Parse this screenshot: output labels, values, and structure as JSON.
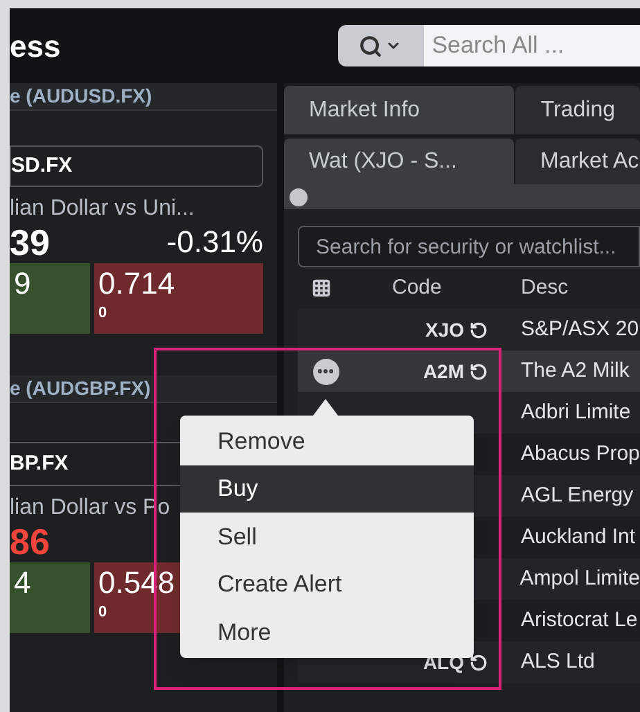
{
  "header": {
    "title": "ess",
    "search": {
      "placeholder": "Search All ..."
    }
  },
  "fx_cards": [
    {
      "title": "e (AUDUSD.FX)",
      "code": "SD.FX",
      "name": "lian Dollar vs Uni...",
      "price": {
        "text": "39",
        "color": "#ffffff"
      },
      "change": "-0.31%",
      "bid": "9",
      "ask": "0.714",
      "ask_volume": "0"
    },
    {
      "title": "e (AUDGBP.FX)",
      "code": "BP.FX",
      "name": "lian Dollar vs Po",
      "price": {
        "text": "86",
        "color": "#f0443c"
      },
      "bid": "4",
      "ask": "0.548",
      "ask_volume": "0"
    }
  ],
  "tabs": [
    {
      "label": "Market Info",
      "selected": true
    },
    {
      "label": "Trading",
      "selected": false
    }
  ],
  "subtabs": [
    {
      "label": "Wat (XJO - S...",
      "selected": true
    },
    {
      "label": "Market Ac",
      "selected": false
    }
  ],
  "watchlist": {
    "search": {
      "placeholder": "Search for security or watchlist..."
    },
    "columns": [
      "Code",
      "Desc"
    ],
    "rows": [
      {
        "code": "XJO",
        "desc": "S&P/ASX 20",
        "selected": false
      },
      {
        "code": "A2M",
        "desc": "The A2 Milk",
        "selected": true
      },
      {
        "desc": "Adbri Limite",
        "selected": false
      },
      {
        "desc": "Abacus Prop",
        "selected": false
      },
      {
        "desc": "AGL Energy",
        "selected": false
      },
      {
        "desc": "Auckland Int",
        "selected": false
      },
      {
        "desc": "Ampol Limite",
        "selected": false
      },
      {
        "desc": "Aristocrat Le",
        "selected": false
      },
      {
        "code": "ALQ",
        "desc": "ALS Ltd",
        "selected": false
      }
    ]
  },
  "context_menu": {
    "items": [
      {
        "label": "Remove",
        "selected": false
      },
      {
        "label": "Buy",
        "selected": true
      },
      {
        "label": "Sell",
        "selected": false
      },
      {
        "label": "Create Alert",
        "selected": false
      },
      {
        "label": "More",
        "selected": false
      }
    ]
  }
}
